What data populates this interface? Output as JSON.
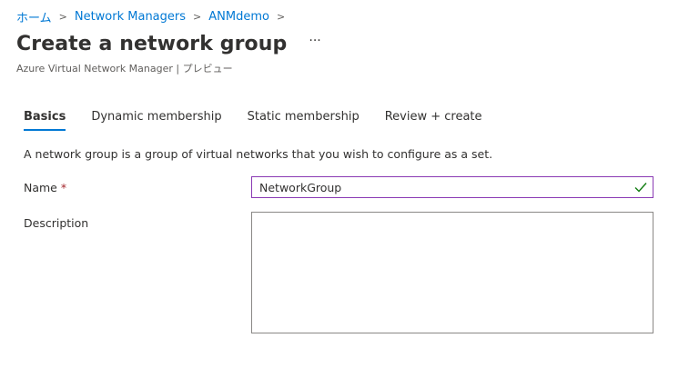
{
  "breadcrumb": {
    "items": [
      "ホーム",
      "Network Managers",
      "ANMdemo"
    ]
  },
  "header": {
    "title": "Create a network group",
    "more_label": "···",
    "subtitle": "Azure Virtual Network Manager | プレビュー"
  },
  "tabs": [
    {
      "label": "Basics",
      "active": true
    },
    {
      "label": "Dynamic membership",
      "active": false
    },
    {
      "label": "Static membership",
      "active": false
    },
    {
      "label": "Review + create",
      "active": false
    }
  ],
  "form": {
    "description_text": "A network group is a group of virtual networks that you wish to configure as a set.",
    "name_label": "Name",
    "required_mark": "*",
    "name_value": "NetworkGroup",
    "description_label": "Description",
    "description_value": ""
  },
  "colors": {
    "link": "#0078d4",
    "active_tab_underline": "#0078d4",
    "focused_input_border": "#8a3ab4",
    "valid_check": "#107c10",
    "required": "#a4262c"
  },
  "icons": {
    "breadcrumb_separator": "chevron-right-icon",
    "valid": "checkmark-icon"
  }
}
